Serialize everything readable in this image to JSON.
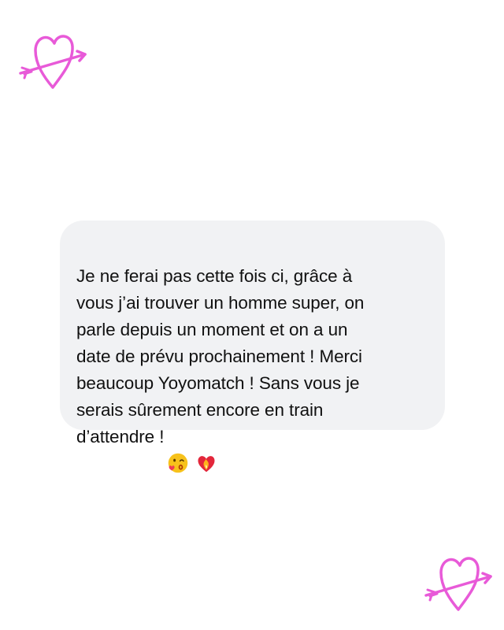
{
  "decorations": {
    "heart_color": "#e85ad8",
    "top_left_icon": "heart-arrow-icon",
    "bottom_right_icon": "heart-arrow-icon"
  },
  "message": {
    "text": "Je ne ferai pas cette fois ci, grâce à\nvous j’ai trouver un homme super, on\nparle depuis un moment et on a un\ndate de prévu prochainement ! Merci\nbeaucoup Yoyomatch ! Sans vous je\nserais sûrement encore en train\nd’attendre !",
    "emojis": [
      "kissing-face-icon",
      "heart-on-fire-icon"
    ],
    "bubble_color": "#f1f2f4",
    "text_color": "#111111"
  }
}
